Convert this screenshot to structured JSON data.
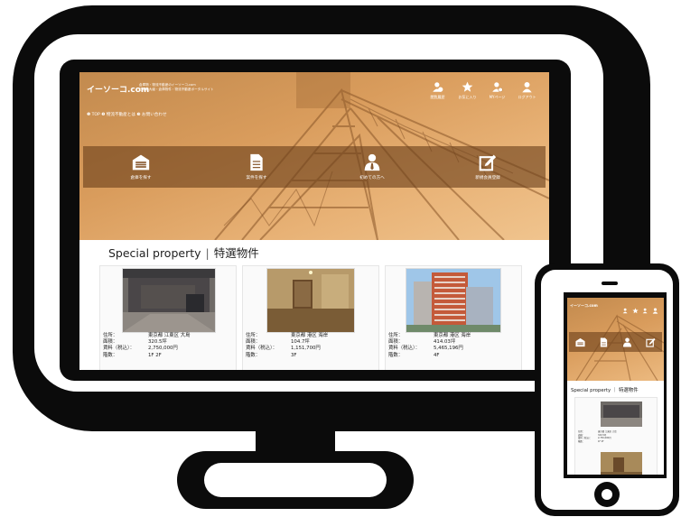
{
  "site": {
    "logo": "イーソーコ.com",
    "tagline": [
      "倉庫物・物流不動産のイーソーコ.com",
      "日本最大級・倉庫物件・物流不動産ポータルサイト"
    ],
    "breadcrumb": "❶ TOP ❷ 物流不動産とは ❸ お問い合わせ"
  },
  "header_nav": [
    {
      "label": "閲覧履歴",
      "icon": "person-history-icon"
    },
    {
      "label": "お気に入り",
      "icon": "star-icon"
    },
    {
      "label": "MYページ",
      "icon": "person-gear-icon"
    },
    {
      "label": "ログアウト",
      "icon": "person-icon"
    }
  ],
  "main_nav": [
    {
      "label": "倉庫を探す",
      "icon": "warehouse-icon"
    },
    {
      "label": "案件を探す",
      "icon": "document-icon"
    },
    {
      "label": "初めての方へ",
      "icon": "user-tie-icon"
    },
    {
      "label": "新規会員登録",
      "icon": "edit-icon"
    }
  ],
  "section": {
    "title_en": "Special property",
    "separator": "|",
    "title_jp": "特選物件"
  },
  "labels": {
    "address": "住所：",
    "area": "面積：",
    "rent": "賃料（税込）：",
    "floor": "階数："
  },
  "properties": [
    {
      "address": "東京都 江東区 大島",
      "area": "320.5坪",
      "rent": "2,750,000円",
      "floor": "1F 2F"
    },
    {
      "address": "東京都 港区 海岸",
      "area": "104.7坪",
      "rent": "1,151,700円",
      "floor": "3F"
    },
    {
      "address": "東京都 港区 海岸",
      "area": "414.03坪",
      "rent": "5,465,196円",
      "floor": "4F"
    }
  ],
  "mobile": {
    "logo": "イーソーコ.com",
    "section": "Special property ｜ 特選物件"
  },
  "colors": {
    "accent": "#d99c5c",
    "nav_overlay": "#6c401c",
    "device": "#0b0b0b"
  }
}
